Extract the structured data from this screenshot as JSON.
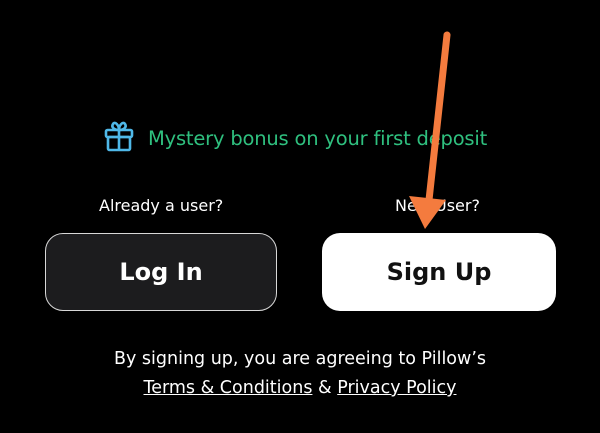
{
  "promo": {
    "icon": "gift-icon",
    "text": "Mystery bonus on your first deposit",
    "text_color": "#2fc07f",
    "icon_color": "#4fb8e8"
  },
  "login": {
    "prompt": "Already a user?",
    "button_label": "Log In"
  },
  "signup": {
    "prompt": "New User?",
    "button_label": "Sign Up"
  },
  "legal": {
    "line1": "By signing up, you are agreeing to Pillow’s",
    "terms_link": "Terms & Conditions",
    "joiner": " & ",
    "privacy_link": "Privacy Policy"
  },
  "annotation": {
    "icon": "arrow-down-icon",
    "color": "#f47b3e"
  }
}
